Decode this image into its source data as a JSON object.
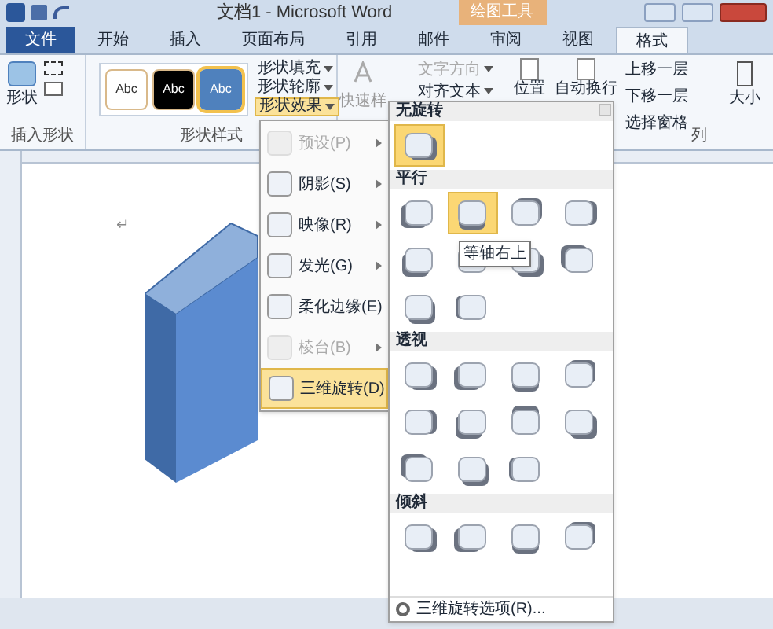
{
  "window": {
    "title": "文档1 - Microsoft Word",
    "context_tab": "绘图工具"
  },
  "tabs": [
    {
      "label": "文件",
      "kind": "file",
      "selected": false
    },
    {
      "label": "开始",
      "kind": "tab",
      "selected": false
    },
    {
      "label": "插入",
      "kind": "tab",
      "selected": false
    },
    {
      "label": "页面布局",
      "kind": "tab",
      "selected": false
    },
    {
      "label": "引用",
      "kind": "tab",
      "selected": false
    },
    {
      "label": "邮件",
      "kind": "tab",
      "selected": false
    },
    {
      "label": "审阅",
      "kind": "tab",
      "selected": false
    },
    {
      "label": "视图",
      "kind": "tab",
      "selected": false
    },
    {
      "label": "格式",
      "kind": "tab",
      "selected": true
    }
  ],
  "ribbon": {
    "insert_shapes": {
      "shape_button": "形状",
      "label": "插入形状"
    },
    "shape_styles": {
      "label": "形状样式",
      "styles": [
        {
          "label": "Abc",
          "color": "#ffffff",
          "selected": false
        },
        {
          "label": "Abc",
          "color": "#000000",
          "selected": false
        },
        {
          "label": "Abc",
          "color": "#4f81bd",
          "selected": true
        }
      ],
      "commands": [
        {
          "label": "形状填充",
          "selected": false
        },
        {
          "label": "形状轮廓",
          "selected": false
        },
        {
          "label": "形状效果",
          "selected": true
        }
      ]
    },
    "quick_styles": "快速样",
    "text": [
      {
        "label": "文字方向",
        "disabled": true
      },
      {
        "label": "对齐文本",
        "disabled": false
      }
    ],
    "arrange": {
      "position": "位置",
      "wrap": "自动换行",
      "commands": [
        "上移一层",
        "下移一层",
        "选择窗格"
      ],
      "label": "列"
    },
    "size": "大小"
  },
  "document": {
    "paragraph_mark": "↵"
  },
  "effects_menu": [
    {
      "label": "预设(P)",
      "disabled": true,
      "selected": false
    },
    {
      "label": "阴影(S)",
      "disabled": false,
      "selected": false
    },
    {
      "label": "映像(R)",
      "disabled": false,
      "selected": false
    },
    {
      "label": "发光(G)",
      "disabled": false,
      "selected": false
    },
    {
      "label": "柔化边缘(E)",
      "disabled": false,
      "selected": false
    },
    {
      "label": "棱台(B)",
      "disabled": true,
      "selected": false
    },
    {
      "label": "三维旋转(D)",
      "disabled": false,
      "selected": true
    }
  ],
  "rotation_gallery": {
    "sections": [
      {
        "title": "无旋转",
        "items": [
          {
            "selected": true
          }
        ]
      },
      {
        "title": "平行",
        "items": [
          {
            "selected": false
          },
          {
            "selected": true
          },
          {
            "selected": false
          },
          {
            "selected": false
          },
          {
            "selected": false
          },
          {
            "selected": false
          },
          {
            "selected": false
          },
          {
            "selected": false
          },
          {
            "selected": false
          },
          {
            "selected": false
          }
        ]
      },
      {
        "title": "透视",
        "items": [
          {
            "selected": false
          },
          {
            "selected": false
          },
          {
            "selected": false
          },
          {
            "selected": false
          },
          {
            "selected": false
          },
          {
            "selected": false
          },
          {
            "selected": false
          },
          {
            "selected": false
          },
          {
            "selected": false
          },
          {
            "selected": false
          },
          {
            "selected": false
          }
        ]
      },
      {
        "title": "倾斜",
        "items": [
          {
            "selected": false
          },
          {
            "selected": false
          },
          {
            "selected": false
          },
          {
            "selected": false
          }
        ]
      }
    ],
    "tooltip": "等轴右上",
    "footer": "三维旋转选项(R)..."
  }
}
